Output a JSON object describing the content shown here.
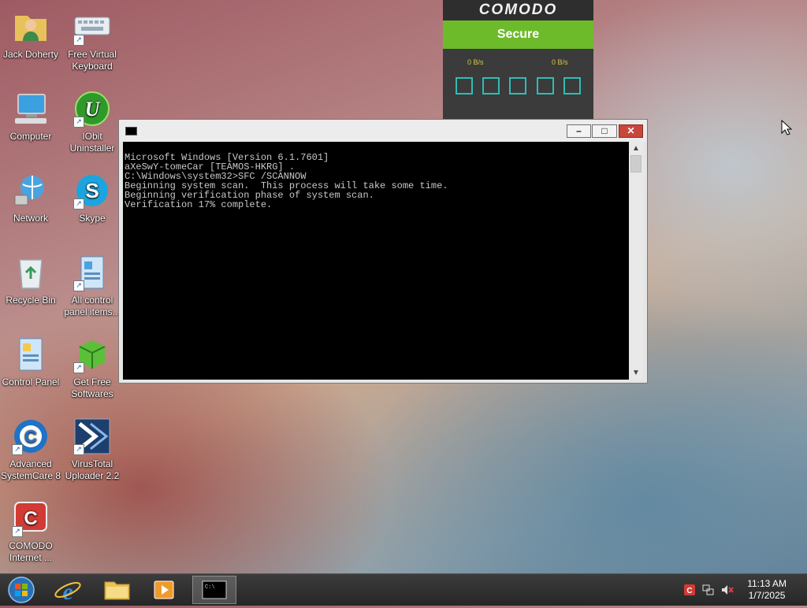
{
  "desktop": {
    "icons": [
      {
        "label": "Jack Doherty",
        "icon": "user-folder-icon"
      },
      {
        "label": "Free Virtual Keyboard",
        "icon": "keyboard-icon"
      },
      {
        "label": "Computer",
        "icon": "computer-icon"
      },
      {
        "label": "IObit Uninstaller",
        "icon": "iobit-uninstaller-icon"
      },
      {
        "label": "Network",
        "icon": "network-icon"
      },
      {
        "label": "Skype",
        "icon": "skype-icon"
      },
      {
        "label": "Recycle Bin",
        "icon": "recycle-bin-icon"
      },
      {
        "label": "All control panel items...",
        "icon": "control-panel-items-icon"
      },
      {
        "label": "Control Panel",
        "icon": "control-panel-icon"
      },
      {
        "label": "Get Free Softwares",
        "icon": "get-free-softwares-icon"
      },
      {
        "label": "Advanced SystemCare 8",
        "icon": "advanced-systemcare-icon"
      },
      {
        "label": "VirusTotal Uploader 2.2",
        "icon": "virustotal-icon"
      },
      {
        "label": "COMODO Internet ...",
        "icon": "comodo-icon"
      }
    ]
  },
  "comodo_widget": {
    "brand": "COMODO",
    "status": "Secure",
    "download_rate": "0 B/s",
    "upload_rate": "0 B/s",
    "colors": {
      "status_bg": "#6dbb2a",
      "tool_border": "#2ebdb6"
    }
  },
  "cmd_window": {
    "lines": [
      "Microsoft Windows [Version 6.1.7601]",
      "aXeSwY-tomeCar [TEAMOS-HKRG] .",
      "",
      "C:\\Windows\\system32>SFC /SCANNOW",
      "",
      "Beginning system scan.  This process will take some time.",
      "",
      "Beginning verification phase of system scan.",
      "Verification 17% complete."
    ],
    "buttons": {
      "minimize": "–",
      "maximize": "□",
      "close": "✕"
    }
  },
  "taskbar": {
    "items": [
      "start-orb",
      "internet-explorer",
      "file-explorer",
      "media-player",
      "command-prompt"
    ],
    "clock_time": "11:13 AM",
    "clock_date": "1/7/2025"
  }
}
